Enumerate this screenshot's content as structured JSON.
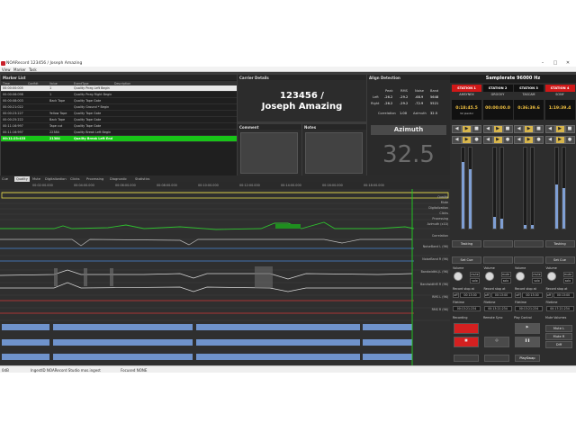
{
  "window": {
    "title": "NOARecord 123456 / Joseph Amazing",
    "menu": [
      "View",
      "Marker",
      "Task"
    ]
  },
  "marker_list": {
    "title": "Marker List",
    "columns": [
      "Time",
      "Confidt",
      "Value",
      "EventType",
      "Description"
    ],
    "rows": [
      {
        "time": "00:00:00:005",
        "conf": "",
        "value": "1",
        "type": "Quality Pneg Left Begin",
        "style": "white"
      },
      {
        "time": "00:00:06:098",
        "conf": "",
        "value": "1",
        "type": "Quality Pneg Right Begin",
        "style": ""
      },
      {
        "time": "00:00:08:003",
        "conf": "",
        "value": "Back Tape",
        "type": "Quality Tape Gate",
        "style": ""
      },
      {
        "time": "00:00:21:022",
        "conf": "",
        "value": "",
        "type": "Quality Ground * Begin",
        "style": ""
      },
      {
        "time": "00:00:23:227",
        "conf": "",
        "value": "Yellow Tape",
        "type": "Quality Tape Gate",
        "style": ""
      },
      {
        "time": "00:00:25:222",
        "conf": "",
        "value": "Back Tape",
        "type": "Quality Tape Gate",
        "style": ""
      },
      {
        "time": "00:11:16:997",
        "conf": "",
        "value": "Tape cut",
        "type": "Quality Tape Gate",
        "style": ""
      },
      {
        "time": "00:11:16:997",
        "conf": "",
        "value": "22384",
        "type": "Quality Break Left Begin",
        "style": ""
      },
      {
        "time": "00:11:23:433",
        "conf": "",
        "value": "21384",
        "type": "Quality Break Left End",
        "style": "green"
      }
    ]
  },
  "carrier": {
    "title": "Carrier Details",
    "line1": "123456 /",
    "line2": "Joseph Amazing"
  },
  "comment": {
    "title": "Comment"
  },
  "notes": {
    "title": "Notes"
  },
  "align": {
    "title": "Align Detection",
    "headers": [
      "Peak",
      "RMS",
      "Noise",
      "Band"
    ],
    "left_label": "Left",
    "right_label": "Right",
    "left": [
      "-26.2",
      "-29.2",
      "-68.9",
      "5648"
    ],
    "right": [
      "-26.2",
      "-29.2",
      "-72.9",
      "5521"
    ],
    "correlation_label": "Correlation",
    "correlation": "1.00",
    "azimuth_label": "Azimuth",
    "azimuth_small": "32.5",
    "azimuth_button": "Azimuth",
    "azimuth_value": "32.5"
  },
  "tabs": [
    "Cue",
    "Quality",
    "Mute",
    "Digitalization",
    "Clicks",
    "Processing",
    "Diagnostic",
    "Statistics"
  ],
  "active_tab": "Quality",
  "timeline": [
    "00:02:00.000",
    "00:04:00.000",
    "00:06:00.000",
    "00:08:00.000",
    "00:10:00.000",
    "00:12:00.000",
    "00:14:00.000",
    "00:16:00.000",
    "00:18:00.000"
  ],
  "channels": [
    "Quality",
    "Mute",
    "Digitalization",
    "Clicks",
    "Processing",
    "Azimuth (x10)",
    "Correlation",
    "NoiseBand L (96)",
    "NoiseBand R (96)",
    "BandwidthL(L (96)",
    "BandwidthR R (96)",
    "RMS L (96)",
    "RMS R (96)"
  ],
  "right": {
    "samplerate_label": "Samplerate",
    "samplerate": "96000 Hz",
    "stations": [
      {
        "name": "STATION 1",
        "color": "#d01818",
        "device": "AMSYNEX",
        "tc": "0:18:45.5",
        "sub": "32 plextor"
      },
      {
        "name": "STATION 2",
        "color": "#101010",
        "device": "GROOVY",
        "tc": "00:00:00.0",
        "sub": ""
      },
      {
        "name": "STATION 3",
        "color": "#101010",
        "device": "TASCAM",
        "tc": "0:36:39.6",
        "sub": ""
      },
      {
        "name": "STATION 4",
        "color": "#d01818",
        "device": "SONY",
        "tc": "1:19:39.4",
        "sub": ""
      }
    ],
    "tasking": "Tasking",
    "set_cue": "Set Cue",
    "volume": "Volume",
    "mute": "mute",
    "solo": "solo",
    "off": "off",
    "record_stop_at": "Record stop at",
    "times": [
      "00:13:00",
      "00:13:00",
      "00:13:00",
      "00:13:00"
    ],
    "filetime": "Filetime",
    "filetimes": [
      "00:13:21:234",
      "00:13:21:234",
      "00:13:21:234",
      "00:17:21:234"
    ],
    "recording": "Recording",
    "remote_sync": "Remote Sync",
    "play_control": "Play Control",
    "mute_volumes": "Mute Volumes",
    "mute_l": "Mute L",
    "mute_r": "Mute R",
    "diff": "Diff",
    "play_swap": "PlaySwap"
  },
  "status": {
    "left": "0dB",
    "middle": "IngestID NOARecord Studio mos.ingest",
    "right": "Focused NONE"
  }
}
